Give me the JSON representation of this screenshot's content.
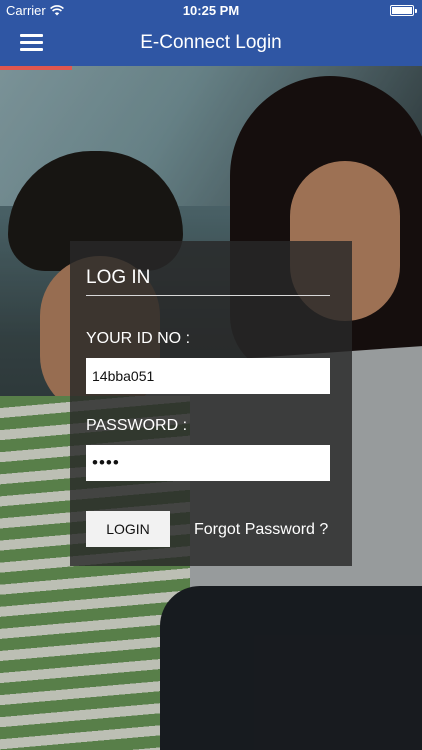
{
  "status_bar": {
    "carrier": "Carrier",
    "wifi_icon": "wifi-icon",
    "time": "10:25 PM",
    "battery_icon": "battery-icon"
  },
  "nav": {
    "menu_icon": "hamburger-menu-icon",
    "title": "E-Connect Login"
  },
  "colors": {
    "nav_background": "#2f56a4",
    "accent": "#e0574f"
  },
  "login": {
    "heading": "LOG IN",
    "id_label": "YOUR ID NO :",
    "id_value": "14bba051",
    "password_label": "PASSWORD :",
    "password_value": "••••",
    "login_button": "LOGIN",
    "forgot_link": "Forgot Password ?"
  }
}
